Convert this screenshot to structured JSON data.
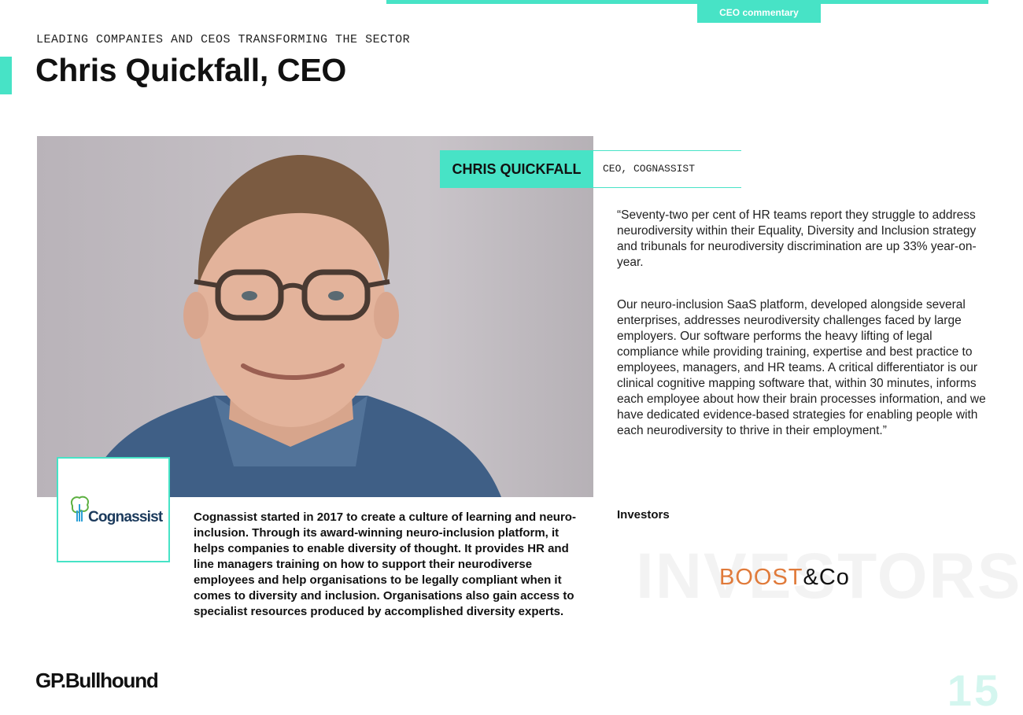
{
  "header": {
    "section_tab": "CEO commentary",
    "kicker": "LEADING COMPANIES AND CEOS TRANSFORMING THE SECTOR",
    "title": "Chris Quickfall, CEO"
  },
  "profile": {
    "name": "CHRIS QUICKFALL",
    "role": "CEO, COGNASSIST",
    "company_logo_text": "Cognassist"
  },
  "company_description": "Cognassist started in 2017 to create a culture of learning and neuro-inclusion. Through its award-winning neuro-inclusion platform, it helps companies to enable diversity of thought. It provides HR and line managers training on how to support their neurodiverse employees and help organisations to be legally compliant when it comes to diversity and inclusion. Organisations also gain access to specialist resources produced by accomplished diversity experts.",
  "quote": {
    "paragraph_1": "“Seventy-two per cent of HR teams report they struggle to address neurodiversity within their Equality, Diversity and Inclusion strategy and tribunals for neurodiversity discrimination are up 33% year-on-year.",
    "paragraph_2": "Our neuro-inclusion SaaS platform, developed alongside several enterprises, addresses neurodiversity challenges faced by large employers. Our software performs the heavy lifting of legal compliance while providing training, expertise and best practice to employees, managers, and HR teams. A critical differentiator is our clinical cognitive mapping software that, within 30 minutes, informs each employee about how their brain processes information, and we have dedicated evidence-based strategies for enabling people with each neurodiversity to thrive in their employment.”"
  },
  "investors": {
    "label": "Investors",
    "watermark": "INVESTORS",
    "logo_part_1": "BOOST",
    "logo_part_2": "&Co"
  },
  "footer": {
    "brand": "GP.Bullhound",
    "page_number": "15"
  },
  "colors": {
    "accent": "#47e3c6",
    "investor_orange": "#e07a3a",
    "page_number": "#d4f6ef"
  }
}
